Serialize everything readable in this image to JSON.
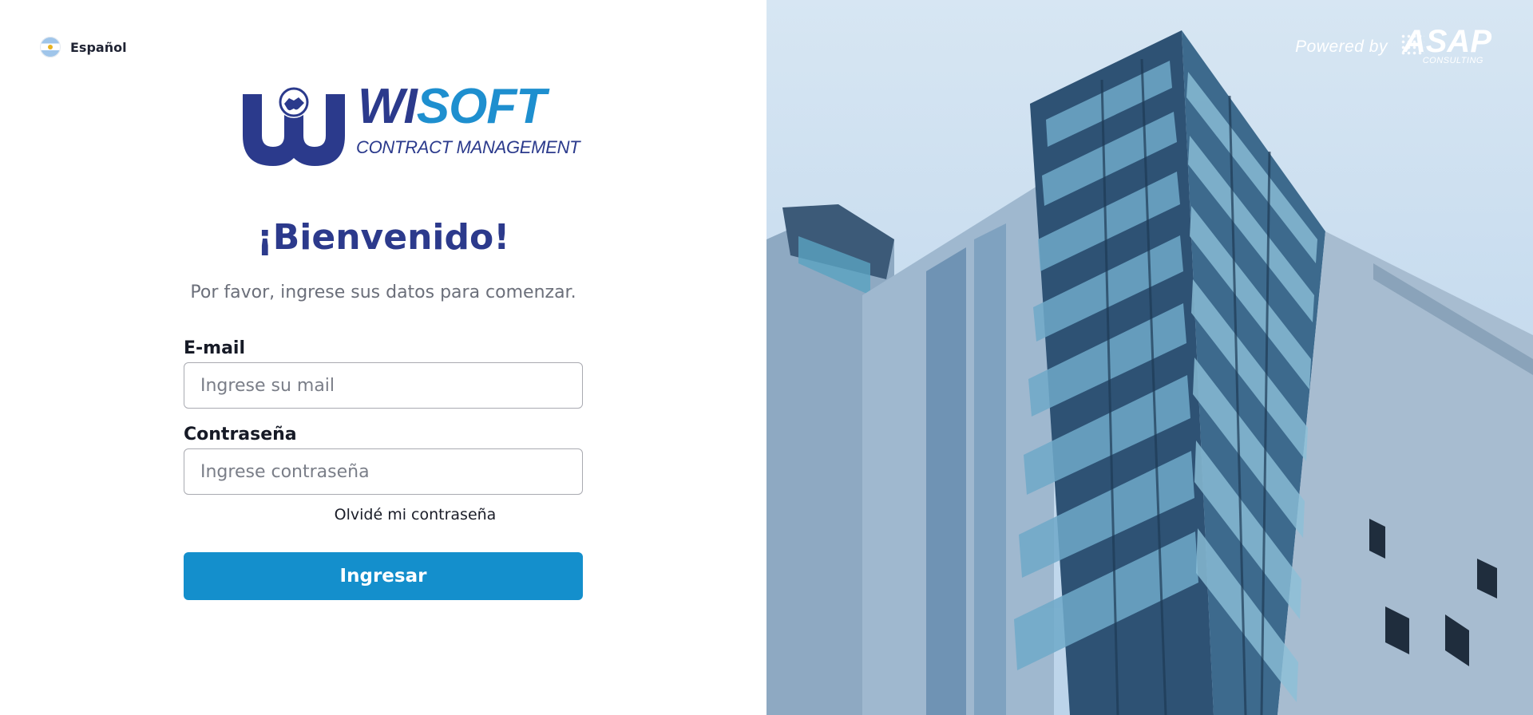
{
  "language": {
    "label": "Español",
    "flag_icon": "argentina-flag-icon"
  },
  "logo": {
    "brand_primary": "WI",
    "brand_secondary": "SOFT",
    "tagline": "CONTRACT MANAGEMENT",
    "icon": "handshake-icon"
  },
  "welcome": {
    "title": "¡Bienvenido!",
    "subtitle": "Por favor, ingrese sus datos para comenzar."
  },
  "form": {
    "email_label": "E-mail",
    "email_placeholder": "Ingrese su mail",
    "email_value": "",
    "password_label": "Contraseña",
    "password_placeholder": "Ingrese contraseña",
    "password_value": "",
    "forgot_link": "Olvidé mi contraseña",
    "submit_label": "Ingresar"
  },
  "footer_brand": {
    "powered_text": "Powered by",
    "company": "ASAP",
    "company_sub": "CONSULTING"
  },
  "colors": {
    "brand_navy": "#2b3a8c",
    "brand_blue": "#1e8fcf",
    "button": "#148fcc",
    "text": "#1a1d28",
    "muted": "#6b6f7a"
  }
}
